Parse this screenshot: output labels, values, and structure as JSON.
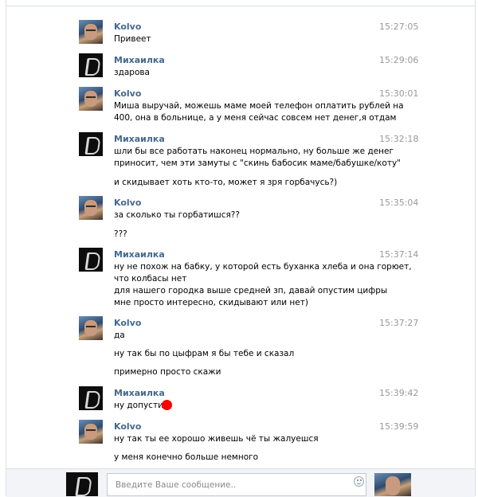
{
  "messages": [
    {
      "author": "Kolvo",
      "time": "15:27:05",
      "lines": [
        "Привеет"
      ]
    },
    {
      "author": "Михаилка",
      "time": "15:29:06",
      "lines": [
        "здарова"
      ]
    },
    {
      "author": "Kolvo",
      "time": "15:30:01",
      "lines": [
        "Миша выручай, можешь маме моей телефон оплатить рублей на",
        "400, она в больнице, а у меня сейчас совсем нет денег,я отдам"
      ]
    },
    {
      "author": "Михаилка",
      "time": "15:32:18",
      "lines": [
        "шли бы все работать наконец нормально, ну больше же денег",
        "приносит, чем эти замуты с \"скинь бабосик маме/бабушке/коту\"",
        "и скидывает хоть кто-то, может я зря горбачусь?)"
      ]
    },
    {
      "author": "Kolvo",
      "time": "15:35:04",
      "lines": [
        "за сколько ты горбатишся??",
        "???"
      ]
    },
    {
      "author": "Михаилка",
      "time": "15:37:14",
      "lines": [
        "ну не похож на бабку, у которой есть буханка хлеба и она горюет,",
        "что колбасы нет",
        "для нашего городка выше средней зп, давай опустим цифры",
        "мне просто интересно, скидывают или нет)"
      ]
    },
    {
      "author": "Kolvo",
      "time": "15:37:27",
      "lines": [
        "да",
        "ну так бы по цыфрам я бы тебе и сказал",
        "примерно просто скажи"
      ]
    },
    {
      "author": "Михаилка",
      "time": "15:39:42",
      "lines": [
        "ну допустим"
      ]
    },
    {
      "author": "Kolvo",
      "time": "15:39:59",
      "lines": [
        "ну так ты ее хорошо живешь чё ты жалуешся",
        "у меня конечно больше немного"
      ]
    }
  ],
  "composer": {
    "placeholder": "Введите Ваше сообщение.."
  }
}
